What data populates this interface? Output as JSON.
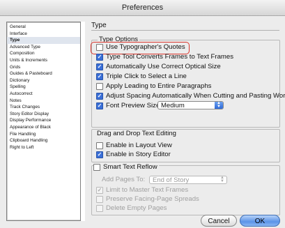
{
  "window": {
    "title": "Preferences"
  },
  "sidebar": {
    "items": [
      {
        "label": "General"
      },
      {
        "label": "Interface"
      },
      {
        "label": "Type",
        "selected": true
      },
      {
        "label": "Advanced Type"
      },
      {
        "label": "Composition"
      },
      {
        "label": "Units & Increments"
      },
      {
        "label": "Grids"
      },
      {
        "label": "Guides & Pasteboard"
      },
      {
        "label": "Dictionary"
      },
      {
        "label": "Spelling"
      },
      {
        "label": "Autocorrect"
      },
      {
        "label": "Notes"
      },
      {
        "label": "Track Changes"
      },
      {
        "label": "Story Editor Display"
      },
      {
        "label": "Display Performance"
      },
      {
        "label": "Appearance of Black"
      },
      {
        "label": "File Handling"
      },
      {
        "label": "Clipboard Handling"
      },
      {
        "label": "Right to Left"
      }
    ]
  },
  "main": {
    "section_title": "Type",
    "type_options": {
      "label": "Type Options",
      "use_typographers_quotes": {
        "label": "Use Typographer's Quotes",
        "checked": false
      },
      "type_tool_converts": {
        "label": "Type Tool Converts Frames to Text Frames",
        "checked": true
      },
      "auto_optical_size": {
        "label": "Automatically Use Correct Optical Size",
        "checked": true
      },
      "triple_click": {
        "label": "Triple Click to Select a Line",
        "checked": true
      },
      "apply_leading": {
        "label": "Apply Leading to Entire Paragraphs",
        "checked": false
      },
      "adjust_spacing": {
        "label": "Adjust Spacing Automatically When Cutting and Pasting Words",
        "checked": true
      },
      "font_preview": {
        "label": "Font Preview Size:",
        "checked": true,
        "value": "Medium"
      }
    },
    "drag_drop": {
      "label": "Drag and Drop Text Editing",
      "layout_view": {
        "label": "Enable in Layout View",
        "checked": false
      },
      "story_editor": {
        "label": "Enable in Story Editor",
        "checked": true
      }
    },
    "smart_reflow": {
      "label": "Smart Text Reflow",
      "checked": false,
      "add_pages_label": "Add Pages To:",
      "add_pages_value": "End of Story",
      "limit_master": {
        "label": "Limit to Master Text Frames",
        "checked": true
      },
      "preserve_spreads": {
        "label": "Preserve Facing-Page Spreads",
        "checked": false
      },
      "delete_empty": {
        "label": "Delete Empty Pages",
        "checked": false
      }
    }
  },
  "buttons": {
    "cancel": "Cancel",
    "ok": "OK"
  },
  "colors": {
    "highlight": "#d9342b",
    "accent": "#3a6fd8"
  }
}
